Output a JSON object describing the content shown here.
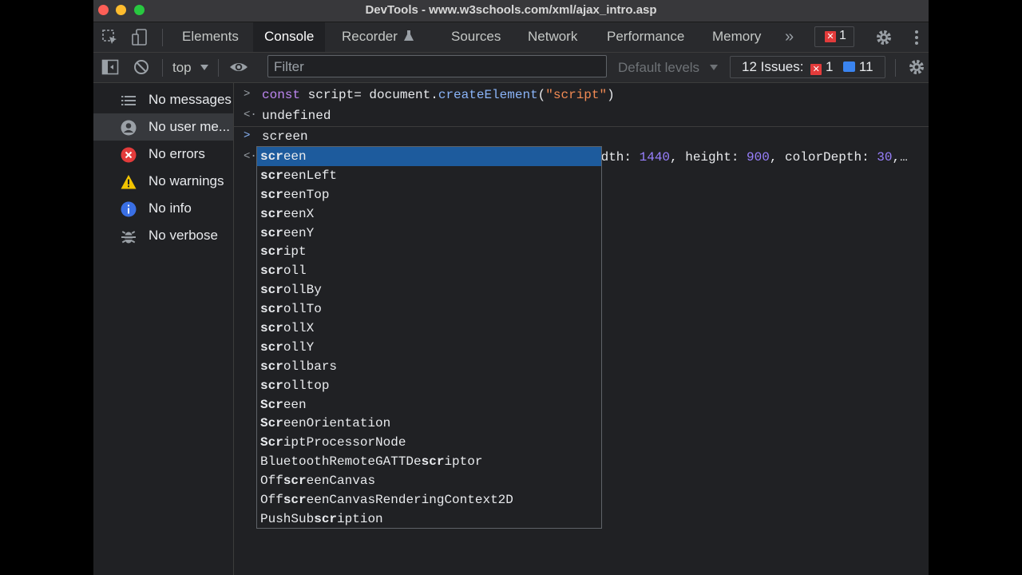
{
  "window": {
    "title": "DevTools - www.w3schools.com/xml/ajax_intro.asp"
  },
  "tabs": [
    {
      "label": "Elements"
    },
    {
      "label": "Console"
    },
    {
      "label": "Recorder"
    },
    {
      "label": "Sources"
    },
    {
      "label": "Network"
    },
    {
      "label": "Performance"
    },
    {
      "label": "Memory"
    }
  ],
  "tabbar": {
    "error_count": "1",
    "more_tabs": "»"
  },
  "toolbar": {
    "context": "top",
    "filter_placeholder": "Filter",
    "levels": "Default levels",
    "issues_label": "12 Issues:",
    "issues_errors": "1",
    "issues_info": "11"
  },
  "sidebar": {
    "items": [
      {
        "label": "No messages",
        "icon": "list-icon"
      },
      {
        "label": "No user me...",
        "icon": "user-icon"
      },
      {
        "label": "No errors",
        "icon": "error-icon"
      },
      {
        "label": "No warnings",
        "icon": "warning-icon"
      },
      {
        "label": "No info",
        "icon": "info-icon"
      },
      {
        "label": "No verbose",
        "icon": "bug-icon"
      }
    ]
  },
  "console": {
    "line1": {
      "kw": "const",
      "rest": " script= document.",
      "fn": "createElement",
      "open": "(",
      "str": "\"script\"",
      "close": ")"
    },
    "line2": "undefined",
    "line3": "screen",
    "line4": {
      "p1": "idth: ",
      "v1": "1440",
      "p2": ", height: ",
      "v2": "900",
      "p3": ", colorDepth: ",
      "v3": "30",
      "p4": ",…"
    }
  },
  "autocomplete": [
    {
      "bold": "scr",
      "rest": "een"
    },
    {
      "bold": "scr",
      "rest": "eenLeft"
    },
    {
      "bold": "scr",
      "rest": "eenTop"
    },
    {
      "bold": "scr",
      "rest": "eenX"
    },
    {
      "bold": "scr",
      "rest": "eenY"
    },
    {
      "bold": "scr",
      "rest": "ipt"
    },
    {
      "bold": "scr",
      "rest": "oll"
    },
    {
      "bold": "scr",
      "rest": "ollBy"
    },
    {
      "bold": "scr",
      "rest": "ollTo"
    },
    {
      "bold": "scr",
      "rest": "ollX"
    },
    {
      "bold": "scr",
      "rest": "ollY"
    },
    {
      "bold": "scr",
      "rest": "ollbars"
    },
    {
      "bold": "scr",
      "rest": "olltop"
    },
    {
      "bold": "Scr",
      "rest": "een"
    },
    {
      "bold": "Scr",
      "rest": "eenOrientation"
    },
    {
      "bold": "Scr",
      "rest": "iptProcessorNode"
    },
    {
      "pre": "BluetoothRemoteGATTDe",
      "bold": "scr",
      "rest": "iptor"
    },
    {
      "pre": "Off",
      "bold": "scr",
      "rest": "eenCanvas"
    },
    {
      "pre": "Off",
      "bold": "scr",
      "rest": "eenCanvasRenderingContext2D"
    },
    {
      "pre": "PushSub",
      "bold": "scr",
      "rest": "iption"
    }
  ]
}
